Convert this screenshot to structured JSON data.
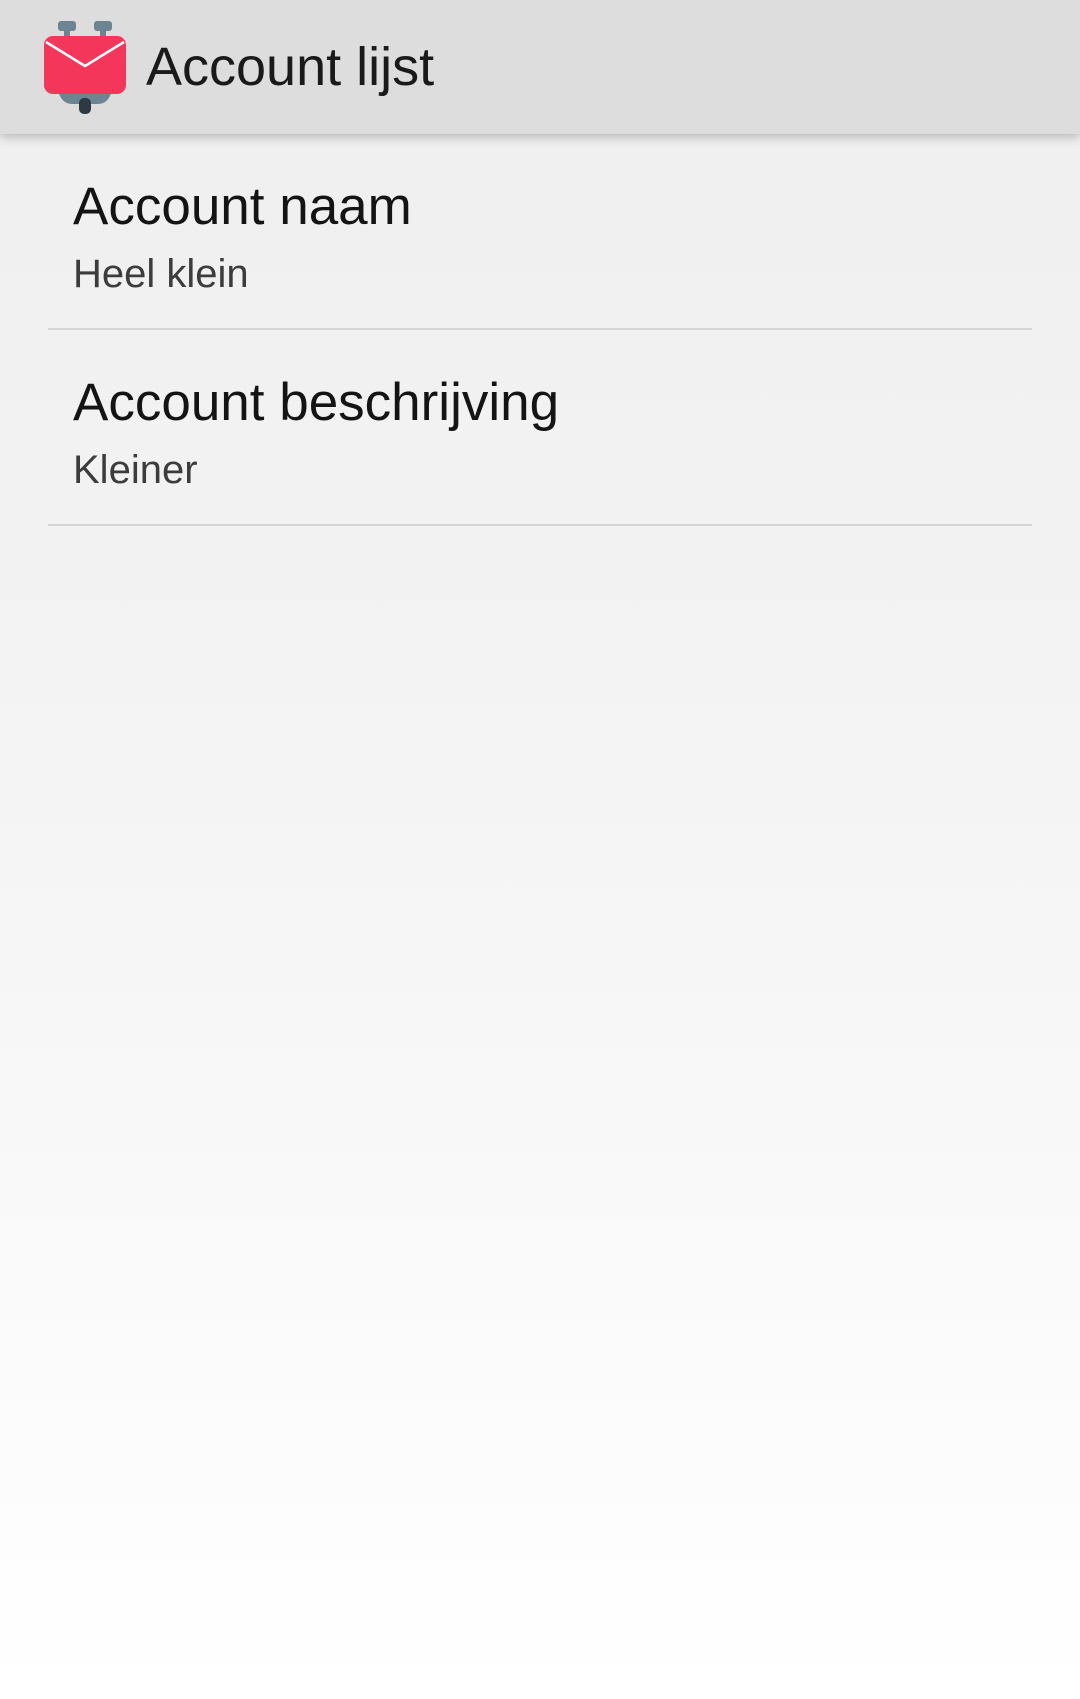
{
  "app_bar": {
    "title": "Account lijst",
    "icon": "k9-mail-logo-icon",
    "accent_color": "#f4365a"
  },
  "preferences": [
    {
      "title": "Account naam",
      "summary": "Heel klein"
    },
    {
      "title": "Account beschrijving",
      "summary": "Kleiner"
    }
  ]
}
